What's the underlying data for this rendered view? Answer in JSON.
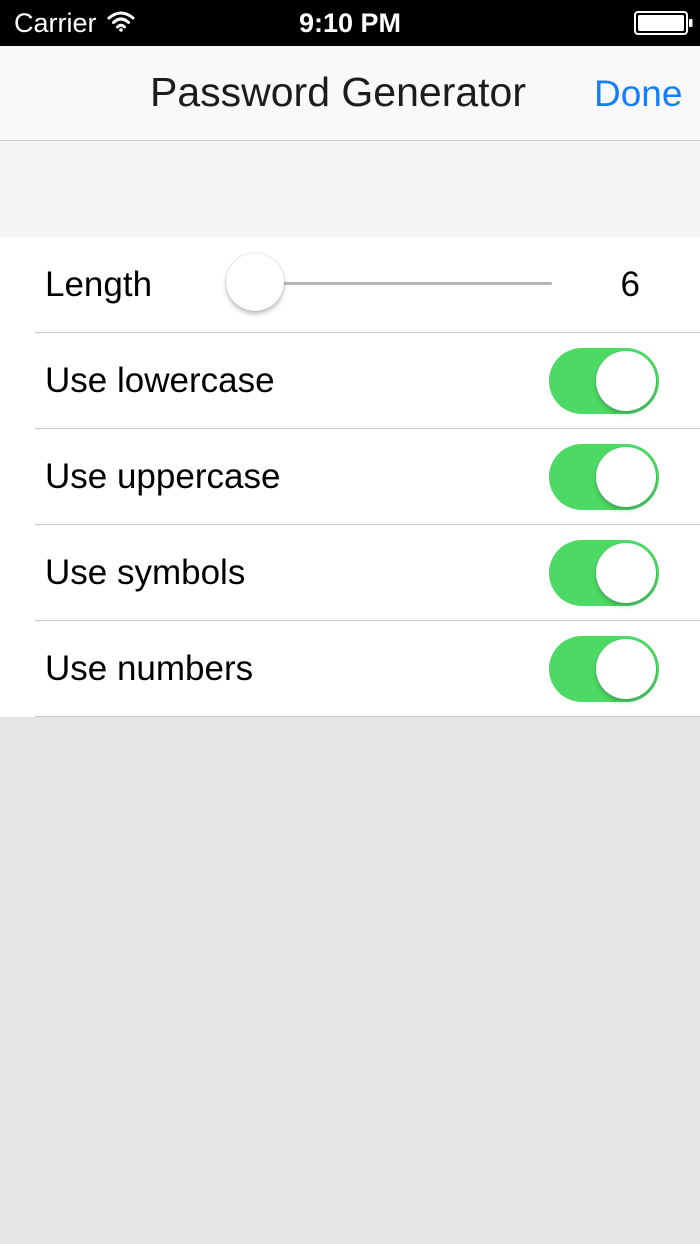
{
  "status_bar": {
    "carrier": "Carrier",
    "time": "9:10 PM",
    "icons": [
      "wifi-icon",
      "battery-icon"
    ]
  },
  "nav": {
    "title": "Password Generator",
    "done_label": "Done"
  },
  "settings": {
    "length": {
      "label": "Length",
      "value": "6",
      "slider_fraction": 0
    },
    "options": [
      {
        "label": "Use lowercase",
        "enabled": true
      },
      {
        "label": "Use uppercase",
        "enabled": true
      },
      {
        "label": "Use symbols",
        "enabled": true
      },
      {
        "label": "Use numbers",
        "enabled": true
      }
    ]
  },
  "colors": {
    "accent": "#157efb",
    "toggle_on": "#4cd964",
    "toggle_off": "#e5e5e5"
  }
}
